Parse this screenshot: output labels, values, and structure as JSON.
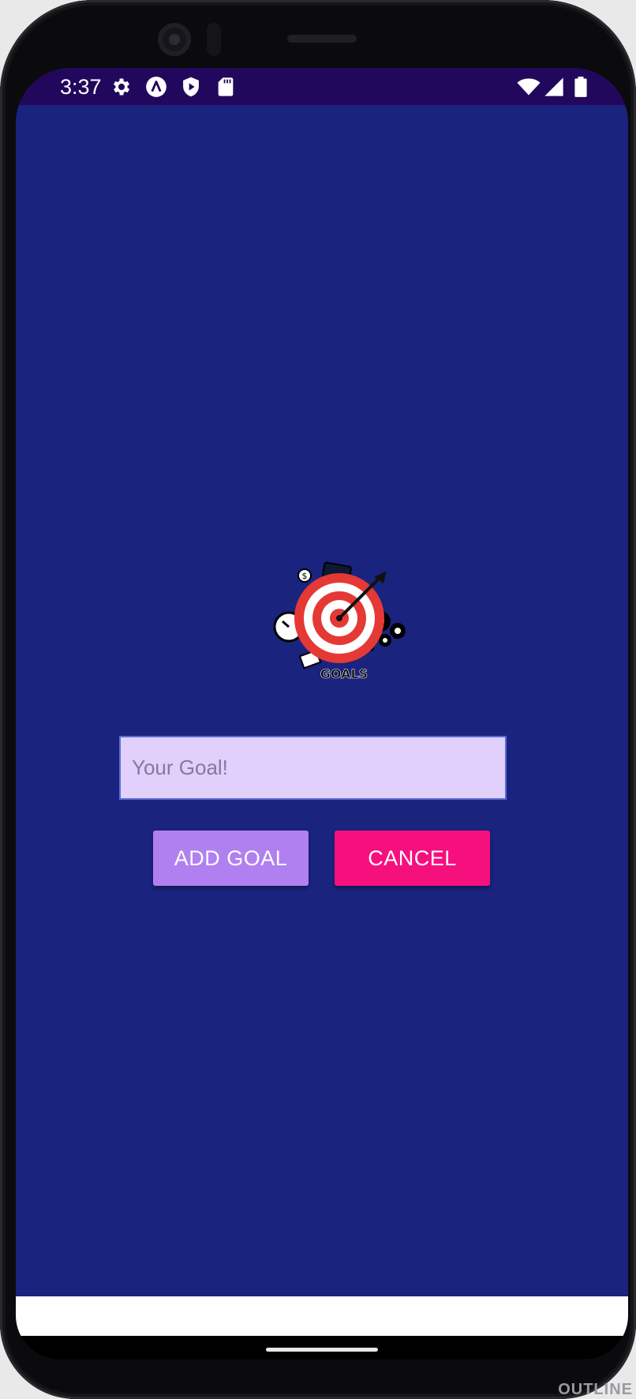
{
  "status_bar": {
    "time": "3:37",
    "icons_left": [
      "settings-gear-icon",
      "a-circle-icon",
      "shield-play-icon",
      "sd-card-icon"
    ],
    "icons_right": [
      "wifi-icon",
      "cell-signal-icon",
      "battery-icon"
    ]
  },
  "logo": {
    "icon": "goals-target-logo",
    "text": "GOALS"
  },
  "goal_input": {
    "placeholder": "Your Goal!",
    "value": ""
  },
  "buttons": {
    "add_label": "ADD GOAL",
    "cancel_label": "CANCEL"
  },
  "colors": {
    "background": "#1a237e",
    "status_bar": "#22085c",
    "input_bg": "#e1cffc",
    "add_button": "#b080f0",
    "cancel_button": "#f5107e"
  },
  "corner_label": "OUTLINE"
}
